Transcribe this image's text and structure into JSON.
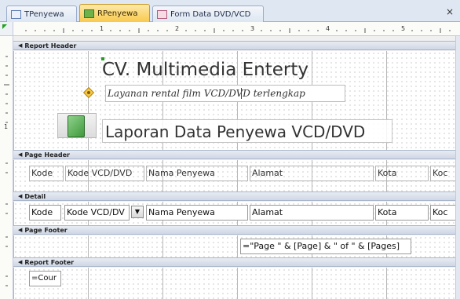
{
  "tabs": [
    {
      "label": "TPenyewa"
    },
    {
      "label": "RPenyewa"
    },
    {
      "label": "Form Data DVD/VCD"
    }
  ],
  "close_glyph": "×",
  "ruler": {
    "h_numbers": [
      "1",
      "2",
      "3",
      "4",
      "5"
    ],
    "v_numbers": [
      "1"
    ]
  },
  "sections": {
    "report_header": "Report Header",
    "page_header": "Page Header",
    "detail": "Detail",
    "page_footer": "Page Footer",
    "report_footer": "Report Footer"
  },
  "report_header": {
    "title": "CV. Multimedia Enterty",
    "subtitle": "Layanan rental film VCD/DVD terlengkap",
    "heading": "Laporan Data Penyewa VCD/DVD"
  },
  "page_header_labels": [
    "Kode",
    "Kode VCD/DVD",
    "Nama Penyewa",
    "Alamat",
    "Kota",
    "Koc"
  ],
  "detail_fields": [
    "Kode",
    "Kode VCD/DV",
    "Nama Penyewa",
    "Alamat",
    "Kota",
    "Koc"
  ],
  "page_footer_expr": "=\"Page \" & [Page] & \" of \" & [Pages]",
  "report_footer_expr": "=Cour",
  "icons": {
    "table_tab": "table-icon",
    "report_tab": "report-icon",
    "form_tab": "form-icon",
    "dropdown": "chevron-down-icon",
    "section": "section-arrow-icon"
  },
  "colors": {
    "active_tab": "#f9c94f",
    "section_bar": "#cfd7e5",
    "selection_handle": "#21a021"
  }
}
